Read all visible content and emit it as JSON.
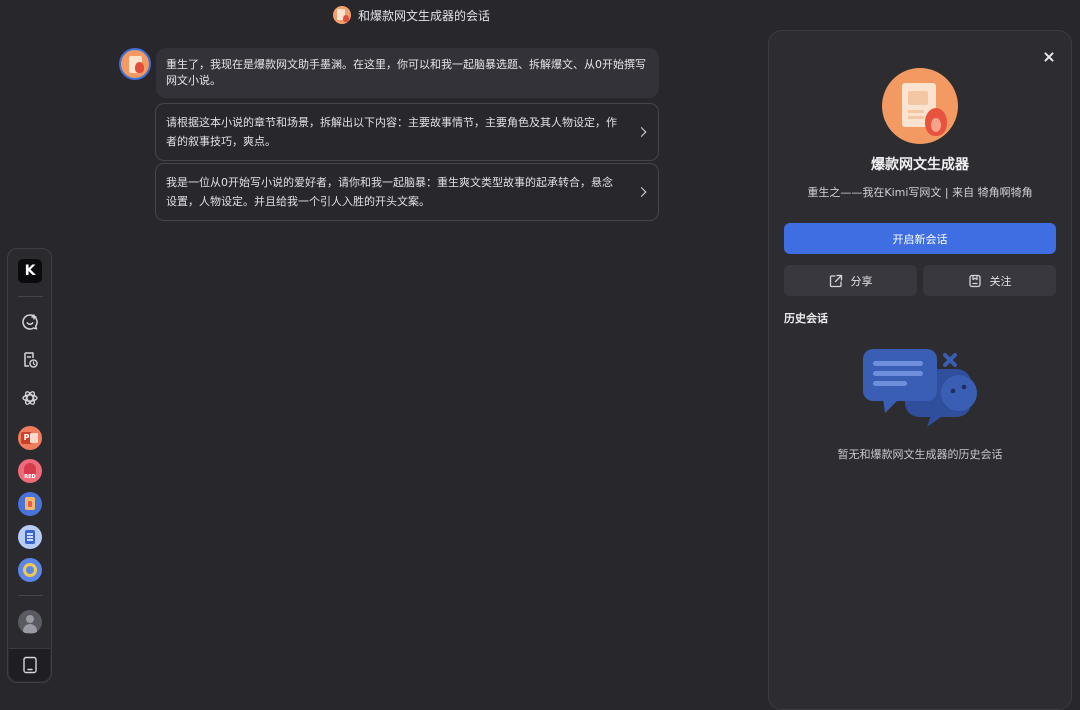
{
  "header": {
    "title": "和爆款网文生成器的会话"
  },
  "chat": {
    "bot_message": "重生了，我现在是爆款网文助手墨渊。在这里，你可以和我一起脑暴选题、拆解爆文、从0开始撰写网文小说。",
    "suggestions": [
      {
        "text": "请根据这本小说的章节和场景，拆解出以下内容：主要故事情节，主要角色及其人物设定，作者的叙事技巧，爽点。"
      },
      {
        "text": "我是一位从0开始写小说的爱好者，请你和我一起脑暴：重生爽文类型故事的起承转合，悬念设置，人物设定。并且给我一个引人入胜的开头文案。"
      }
    ]
  },
  "dock": {
    "logo_text": "K",
    "icons": [
      "new-chat-icon",
      "history-doc-icon",
      "explore-icon",
      "ppt-app-icon",
      "red-app-icon",
      "writer-app-icon",
      "doc-app-icon",
      "search-app-icon",
      "user-icon",
      "tablet-icon"
    ],
    "ppt_letter": "P",
    "red_text": "RED"
  },
  "panel": {
    "name": "爆款网文生成器",
    "description": "重生之——我在Kimi写网文 | 来自 犄角啊犄角",
    "new_chat_label": "开启新会话",
    "share_label": "分享",
    "follow_label": "关注",
    "history_title": "历史会话",
    "empty_text": "暂无和爆款网文生成器的历史会话"
  },
  "colors": {
    "background": "#27272c",
    "panel": "#2c2c31",
    "primary": "#3f6ee3",
    "avatar_orange": "#f39a62",
    "illustration_blue": "#3b5bab"
  }
}
